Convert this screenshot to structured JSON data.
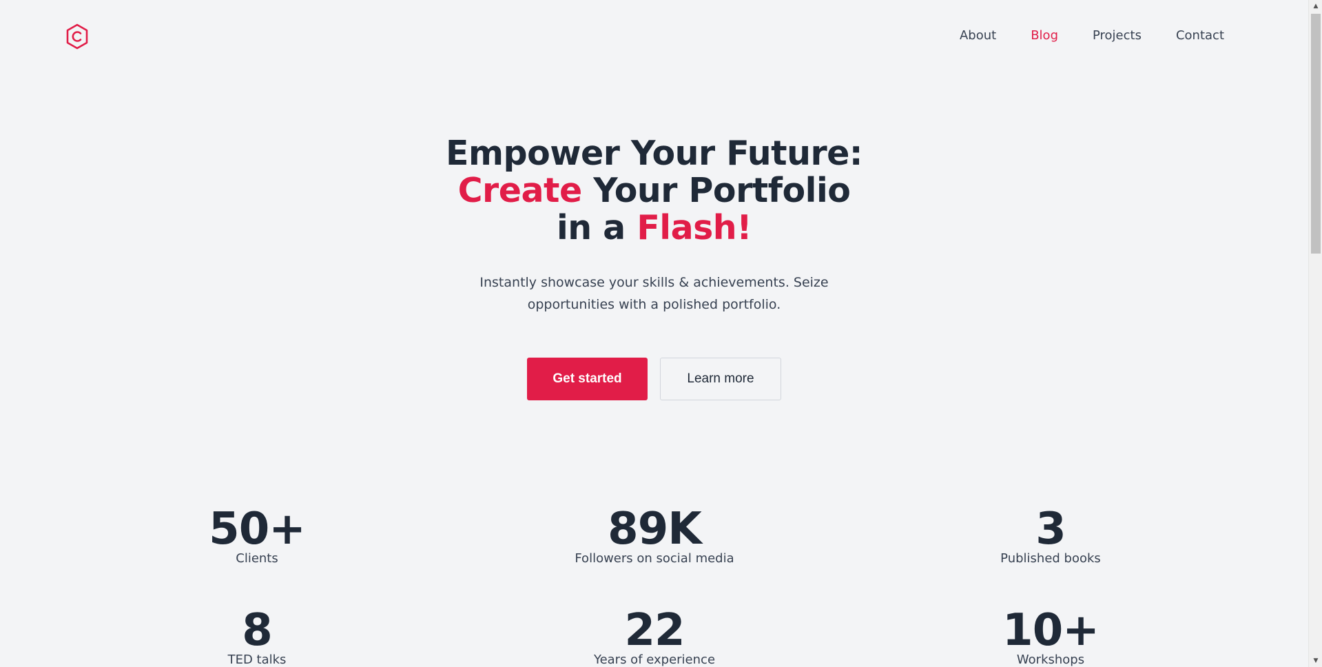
{
  "nav": {
    "about": "About",
    "blog": "Blog",
    "projects": "Projects",
    "contact": "Contact",
    "active": "Blog"
  },
  "hero": {
    "line1": "Empower Your Future:",
    "line2_accent": "Create",
    "line2_rest": " Your Portfolio",
    "line3_start": "in a ",
    "line3_accent": "Flash!",
    "subtitle": "Instantly showcase your skills & achievements. Seize opportunities with a polished portfolio.",
    "primary_button": "Get started",
    "secondary_button": "Learn more"
  },
  "stats": [
    {
      "value": "50+",
      "label": "Clients"
    },
    {
      "value": "89K",
      "label": "Followers on social media"
    },
    {
      "value": "3",
      "label": "Published books"
    },
    {
      "value": "8",
      "label": "TED talks"
    },
    {
      "value": "22",
      "label": "Years of experience"
    },
    {
      "value": "10+",
      "label": "Workshops"
    }
  ],
  "colors": {
    "accent": "#e11d48",
    "text": "#1f2937",
    "background": "#f3f4f6"
  },
  "icons": {
    "logo": "hexagon-c-logo-icon"
  }
}
